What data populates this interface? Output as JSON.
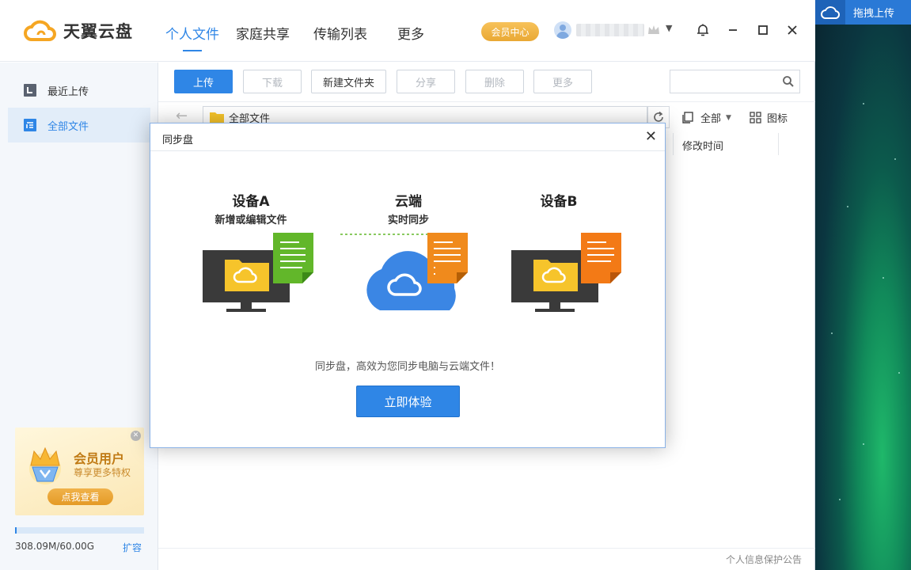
{
  "app": {
    "brand": "天翼云盘"
  },
  "nav": {
    "tabs": [
      {
        "label": "个人文件",
        "active": true
      },
      {
        "label": "家庭共享",
        "active": false
      },
      {
        "label": "传输列表",
        "active": false
      },
      {
        "label": "更多",
        "active": false
      }
    ],
    "vip_center": "会员中心"
  },
  "window_controls": {
    "icons": [
      "bell-icon",
      "minimize-icon",
      "maximize-icon",
      "close-icon"
    ]
  },
  "desktop": {
    "drag_upload": "拖拽上传"
  },
  "sidebar": {
    "items": [
      {
        "label": "最近上传",
        "active": false
      },
      {
        "label": "全部文件",
        "active": true
      }
    ],
    "promo": {
      "title": "会员用户",
      "subtitle": "尊享更多特权",
      "button": "点我查看"
    },
    "storage": {
      "used_fraction": 0.005,
      "text": "308.09M/60.00G",
      "expand": "扩容"
    }
  },
  "toolbar": {
    "upload": "上传",
    "download": "下载",
    "new_folder": "新建文件夹",
    "share": "分享",
    "delete": "删除",
    "more": "更多",
    "search_placeholder": ""
  },
  "addressbar": {
    "path": "全部文件",
    "filter": "全部",
    "view": "图标"
  },
  "columns": {
    "modified": "修改时间"
  },
  "footer": {
    "privacy": "个人信息保护公告"
  },
  "dialog": {
    "title": "同步盘",
    "device_a_title": "设备A",
    "device_a_sub": "新增或编辑文件",
    "cloud_title": "云端",
    "cloud_sub": "实时同步",
    "device_b_title": "设备B",
    "description": "同步盘，高效为您同步电脑与云端文件！",
    "button": "立即体验",
    "colors": {
      "green_doc": "#62b72a",
      "orange_doc": "#f08a1c",
      "cloud": "#3b86e4",
      "folder": "#f6c42b"
    }
  }
}
